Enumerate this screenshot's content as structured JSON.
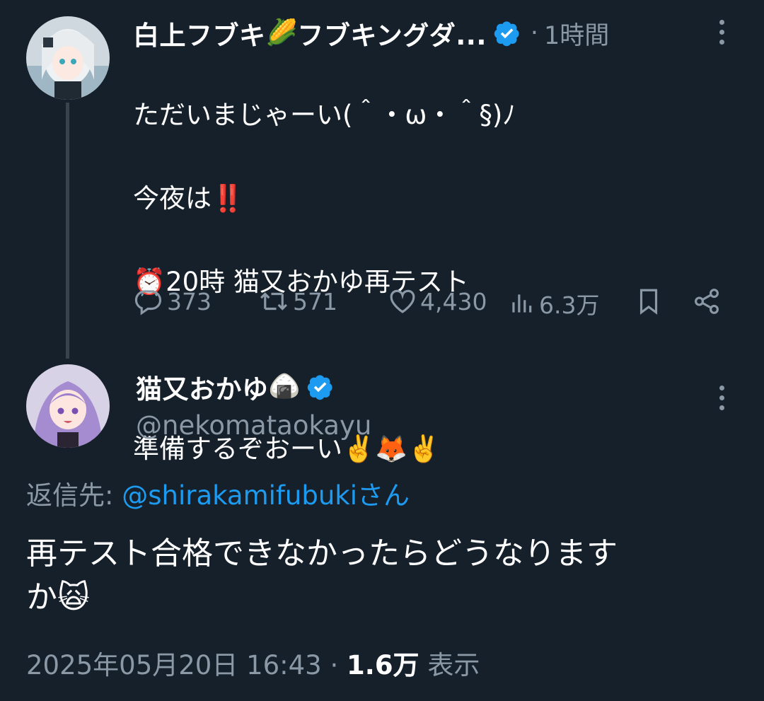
{
  "parent_tweet": {
    "display_name": "白上フブキ",
    "name_emoji": "🌽",
    "name_suffix": "フブキングダ...",
    "verified": true,
    "time_separator": "·",
    "time": "1時間",
    "text_lines": [
      "ただいまじゃーい(＾・ω・＾§)ﾉ",
      "今夜は‼️",
      "⏰20時 猫又おかゆ再テスト",
      "",
      "準備するぞおーい✌️🦊✌️"
    ],
    "stats": {
      "replies": "373",
      "retweets": "571",
      "likes": "4,430",
      "views": "6.3万"
    }
  },
  "main_tweet": {
    "display_name": "猫又おかゆ",
    "name_emoji": "🍙",
    "verified": true,
    "handle": "@nekomataokayu",
    "reply_prefix": "返信先: ",
    "reply_to": "@shirakamifubuki",
    "reply_suffix": "さん",
    "text": "再テスト合格できなかったらどうなります\nか🙀",
    "date": "2025年05月20日 16:43",
    "meta_separator": " · ",
    "views": "1.6万",
    "views_label": " 表示"
  },
  "colors": {
    "background": "#15202b",
    "text": "#ffffff",
    "muted": "#8b98a5",
    "link": "#1d9bf0",
    "verified": "#1d9bf0",
    "thread_line": "#38444d"
  },
  "icons": [
    "verified-badge-icon",
    "more-icon",
    "reply-icon",
    "retweet-icon",
    "like-icon",
    "views-icon",
    "bookmark-icon",
    "share-icon"
  ]
}
